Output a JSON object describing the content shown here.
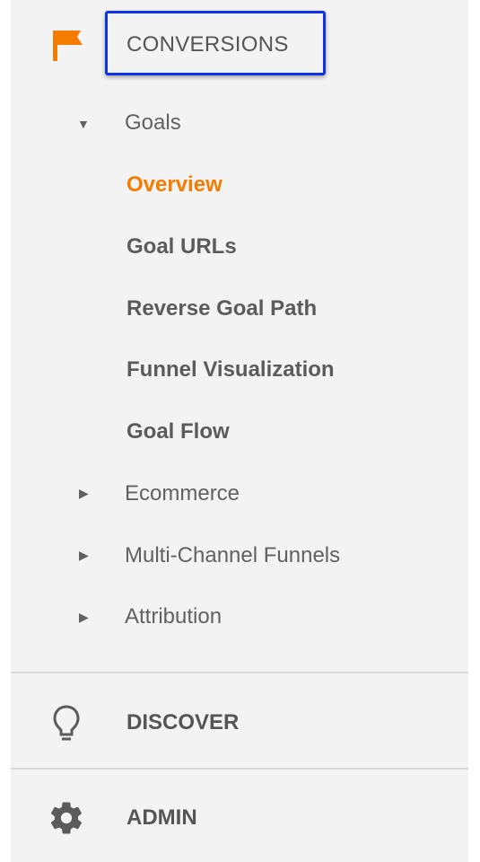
{
  "colors": {
    "accent": "#f57c00",
    "highlight": "#1133e6",
    "panel_bg": "#f3f3f3",
    "text": "#5b5b5b"
  },
  "section": {
    "icon": "flag-icon",
    "title": "CONVERSIONS"
  },
  "tree": {
    "goals": {
      "label": "Goals",
      "expanded": true,
      "items": [
        {
          "label": "Overview",
          "active": true
        },
        {
          "label": "Goal URLs",
          "active": false
        },
        {
          "label": "Reverse Goal Path",
          "active": false
        },
        {
          "label": "Funnel Visualization",
          "active": false
        },
        {
          "label": "Goal Flow",
          "active": false
        }
      ]
    },
    "collapsed": [
      {
        "label": "Ecommerce"
      },
      {
        "label": "Multi-Channel Funnels"
      },
      {
        "label": "Attribution"
      }
    ]
  },
  "footer": {
    "discover": {
      "icon": "lightbulb-icon",
      "label": "DISCOVER"
    },
    "admin": {
      "icon": "gear-icon",
      "label": "ADMIN"
    }
  }
}
